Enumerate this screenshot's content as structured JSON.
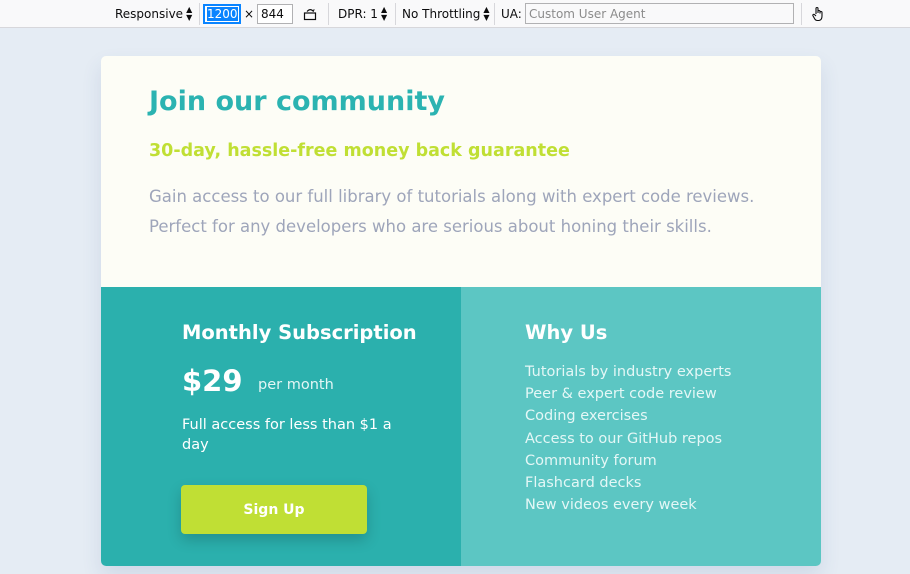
{
  "devtools": {
    "device": "Responsive",
    "width": "1200",
    "times": "×",
    "height": "844",
    "dpr_label": "DPR: 1",
    "throttling": "No Throttling",
    "ua_label": "UA:",
    "ua_placeholder": "Custom User Agent",
    "icons": [
      "rotate-icon",
      "touch-icon"
    ]
  },
  "hero": {
    "title": "Join our community",
    "guarantee": "30-day, hassle-free money back guarantee",
    "description": "Gain access to our full library of tutorials along with expert code reviews. Perfect for any developers who are serious about honing their skills."
  },
  "subscription": {
    "heading": "Monthly Subscription",
    "price": "$29",
    "period": "per month",
    "note": "Full access for less than $1 a day",
    "button_label": "Sign Up"
  },
  "why": {
    "heading": "Why Us",
    "items": [
      "Tutorials by industry experts",
      "Peer & expert code review",
      "Coding exercises",
      "Access to our GitHub repos",
      "Community forum",
      "Flashcard decks",
      "New videos every week"
    ]
  },
  "colors": {
    "page_bg": "#e5ecf4",
    "teal": "#2bb3b1",
    "teal_light": "#5cc6c3",
    "lime": "#c0df34",
    "muted_text": "#9ea5ba",
    "card_top": "#fdfdf6"
  }
}
